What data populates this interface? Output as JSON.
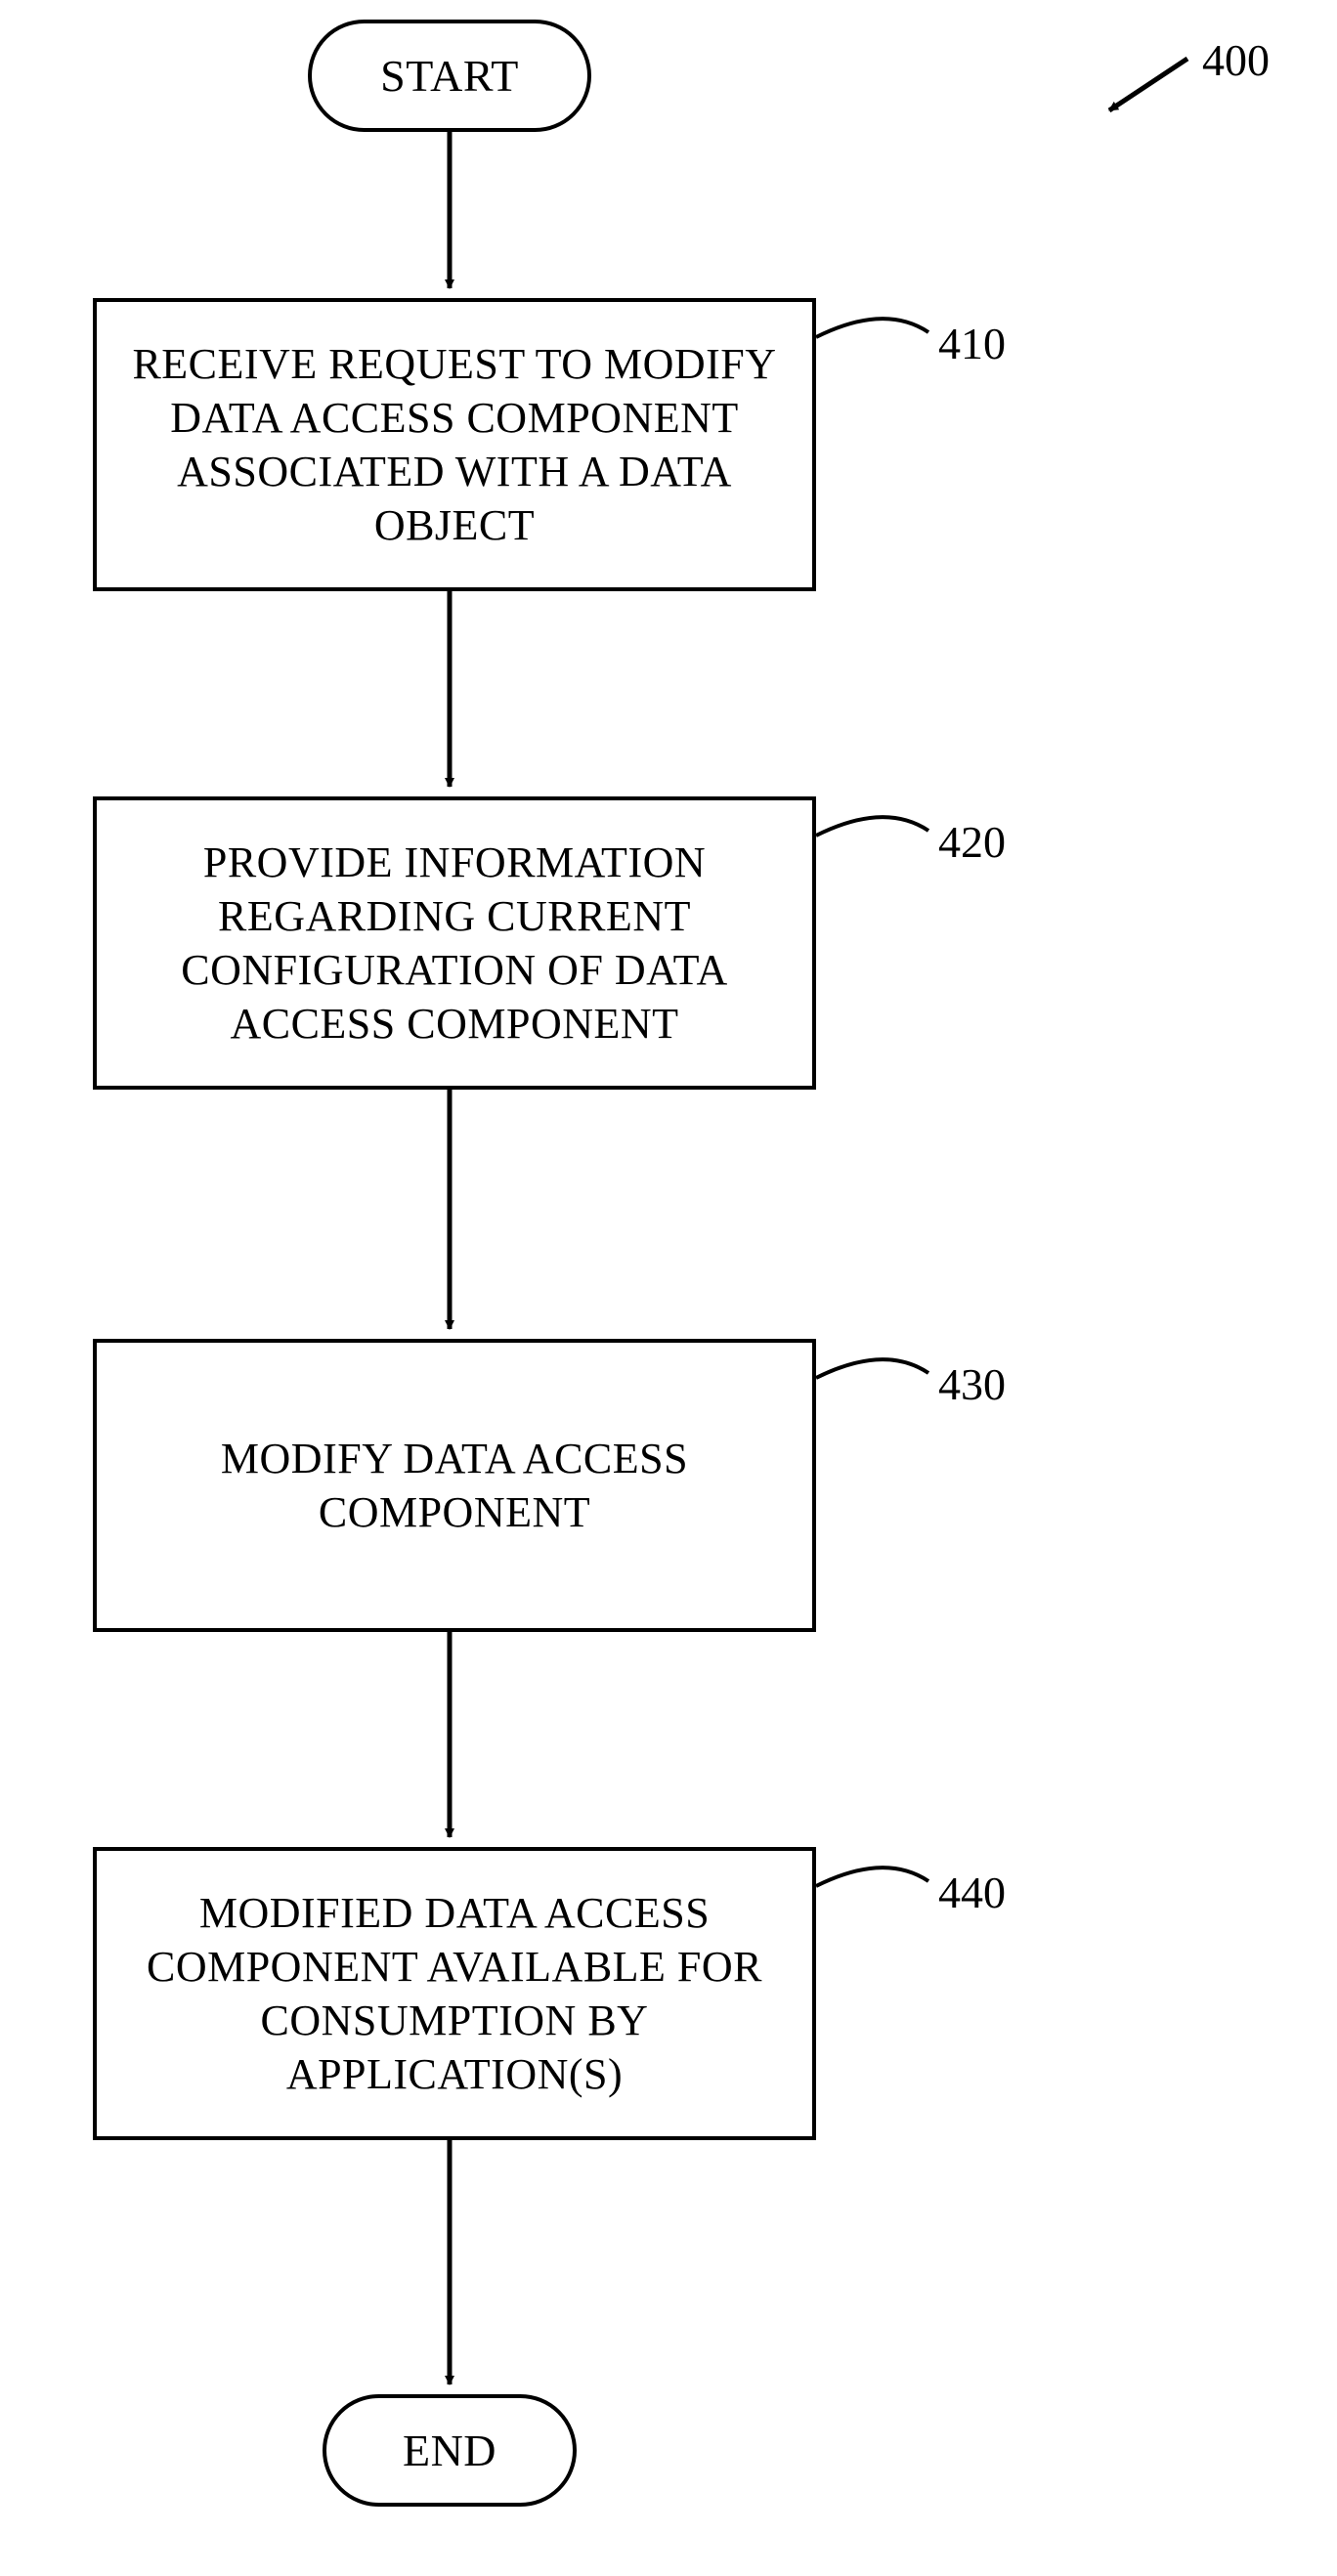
{
  "diagram": {
    "figure_ref": "400",
    "start_label": "START",
    "end_label": "END",
    "steps": [
      {
        "ref": "410",
        "text": "RECEIVE REQUEST TO MODIFY DATA ACCESS COMPONENT ASSOCIATED WITH A DATA OBJECT"
      },
      {
        "ref": "420",
        "text": "PROVIDE INFORMATION REGARDING CURRENT CONFIGURATION OF DATA ACCESS COMPONENT"
      },
      {
        "ref": "430",
        "text": "MODIFY DATA ACCESS COMPONENT"
      },
      {
        "ref": "440",
        "text": "MODIFIED DATA ACCESS COMPONENT AVAILABLE FOR CONSUMPTION BY APPLICATION(S)"
      }
    ]
  }
}
